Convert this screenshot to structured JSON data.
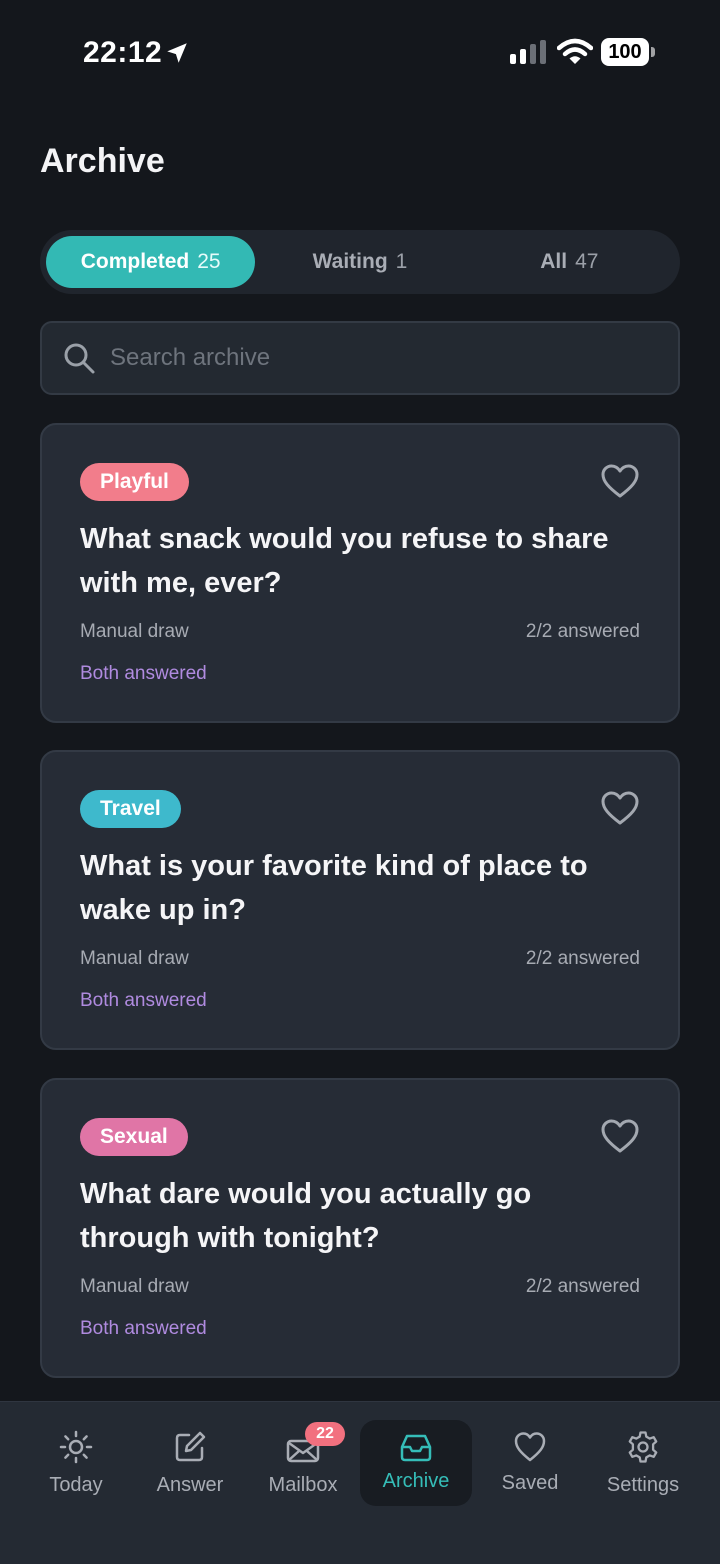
{
  "status_bar": {
    "time": "22:12",
    "battery": "100"
  },
  "page": {
    "title": "Archive"
  },
  "filters": [
    {
      "label": "Completed",
      "count": "25"
    },
    {
      "label": "Waiting",
      "count": "1"
    },
    {
      "label": "All",
      "count": "47"
    }
  ],
  "search": {
    "placeholder": "Search archive",
    "value": ""
  },
  "cards": [
    {
      "tag": "Playful",
      "tag_color": "#f27d8b",
      "question": "What snack would you refuse to share with me, ever?",
      "source": "Manual draw",
      "answered": "2/2 answered",
      "status": "Both answered"
    },
    {
      "tag": "Travel",
      "tag_color": "#3eb9cc",
      "question": "What is your favorite kind of place to wake up in?",
      "source": "Manual draw",
      "answered": "2/2 answered",
      "status": "Both answered"
    },
    {
      "tag": "Sexual",
      "tag_color": "#e075a6",
      "question": "What dare would you actually go through with tonight?",
      "source": "Manual draw",
      "answered": "2/2 answered",
      "status": "Both answered"
    }
  ],
  "tabbar": {
    "tabs": [
      {
        "label": "Today",
        "icon": "sun-icon"
      },
      {
        "label": "Answer",
        "icon": "edit-icon"
      },
      {
        "label": "Mailbox",
        "icon": "mail-icon",
        "badge": "22"
      },
      {
        "label": "Archive",
        "icon": "archive-icon"
      },
      {
        "label": "Saved",
        "icon": "heart-icon"
      },
      {
        "label": "Settings",
        "icon": "gear-icon"
      }
    ]
  },
  "colors": {
    "accent": "#33b9b4",
    "background": "#14171c",
    "card": "#262c36",
    "status_purple": "#b08be0",
    "badge": "#f2707f"
  }
}
